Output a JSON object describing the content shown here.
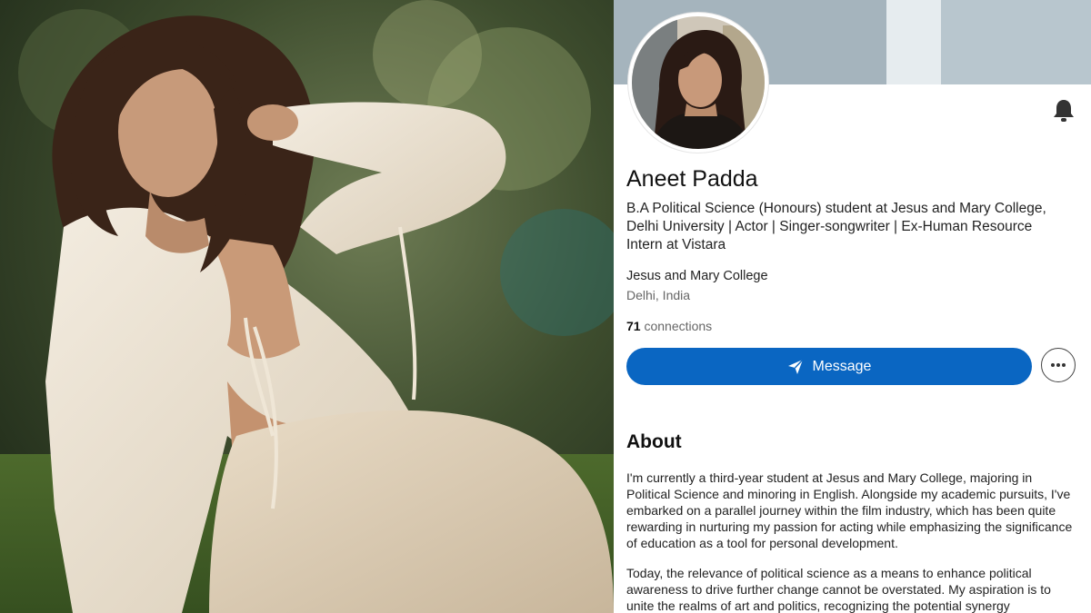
{
  "profile": {
    "name": "Aneet Padda",
    "headline": "B.A Political Science (Honours) student at Jesus and Mary College, Delhi University | Actor | Singer-songwriter | Ex-Human Resource Intern at Vistara",
    "school": "Jesus and Mary College",
    "location": "Delhi, India",
    "connections_count": "71",
    "connections_label": "connections",
    "message_button_label": "Message",
    "more_button_icon": "more-horizontal-icon",
    "notifications_icon": "bell-icon"
  },
  "about": {
    "title": "About",
    "paragraph_1": "I'm currently a third-year student at Jesus and Mary College, majoring in Political Science and minoring in English. Alongside my academic pursuits, I've embarked on a parallel journey within the film industry, which has been quite rewarding in nurturing my passion for acting while emphasizing the significance of education as a tool for personal development.",
    "paragraph_2": "Today, the relevance of political science as a means to enhance political awareness to drive further change cannot be overstated. My aspiration is to unite the realms of art and politics, recognizing the potential synergy"
  },
  "colors": {
    "accent": "#0a66c2",
    "text": "#111111",
    "muted": "#666666"
  }
}
